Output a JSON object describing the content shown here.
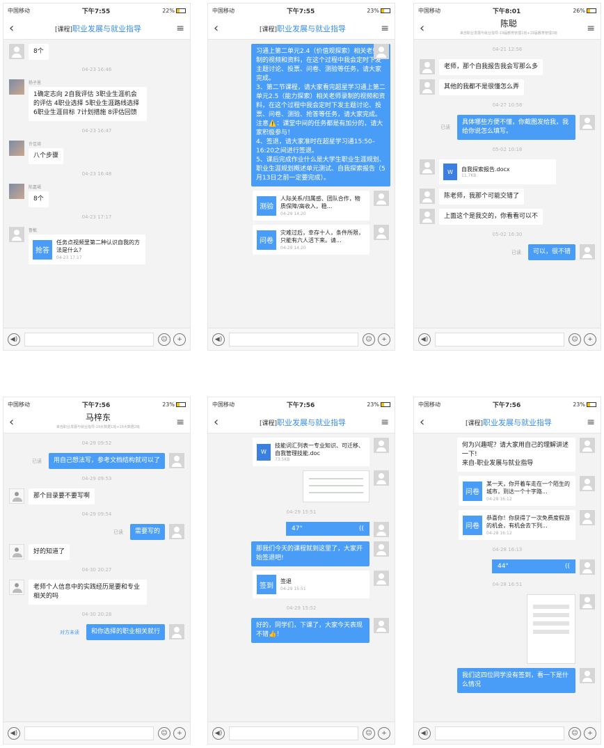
{
  "status_bar": {
    "carrier": "中国移动",
    "battery_icon": "battery-icon"
  },
  "course_tag": "[课程]",
  "course_title": "职业发展与就业指导",
  "back_icon": "‹",
  "menu_icon": "≡",
  "phones": [
    {
      "time": "下午7:55",
      "battery": "22%",
      "messages": [
        {
          "kind": "text",
          "side": "left",
          "text": "8个"
        },
        {
          "kind": "ts",
          "text": "04-23 16:46"
        },
        {
          "kind": "text",
          "side": "left",
          "avatar": "photo",
          "name": "杨子恩",
          "text": "1确定志向 2自我评估 3职业生涯机会的评估 4职业选择 5职业生涯路线选择 6职业生涯目标 7计划措施 8评估回馈"
        },
        {
          "kind": "ts",
          "text": "04-23 16:47"
        },
        {
          "kind": "text",
          "side": "left",
          "avatar": "photo",
          "name": "许佳琦",
          "text": "八个步骤"
        },
        {
          "kind": "ts",
          "text": "04-23 16:48"
        },
        {
          "kind": "text",
          "side": "left",
          "avatar": "photo",
          "name": "陈嘉珺",
          "text": "8个"
        },
        {
          "kind": "ts",
          "text": "04-23 17:17"
        },
        {
          "kind": "card",
          "side": "left",
          "name": "鲁敏",
          "icon": "抢答",
          "title": "任务点视频里第二种认识自我的方法是什么?",
          "date": "04-23 17:17"
        }
      ]
    },
    {
      "time": "下午7:55",
      "battery": "23%",
      "messages": [
        {
          "kind": "text",
          "side": "right",
          "color": "blue",
          "wide": true,
          "text": "习通上第二单元2.4（价值观探索）相关老师录制的视频和资料，在这个过程中我会定时下发主题讨论、投票、问卷、测验等任务，请大家完成。\n3、第二节课程，请大家看完超星学习通上第二单元2.5（能力探索）相关老师录制的视频和资料，在这个过程中我会定时下发主题讨论、投票、问卷、测验、抢答等任务，请大家完成。\n注意⚠️：课堂中间的任务都是有加分的，请大家积极参与！\n4、签退，请大家准时在超星学习通15:50–16:20之间进行签退。\n5、课后完成作业什么是大学生职业生涯规划、职业生涯规划概述单元测试、自我探索报告（5月13日之前一定要完成）。"
        },
        {
          "kind": "card",
          "side": "right",
          "icon": "测验",
          "title": "人际关系/归属感、团队合作，物质保障/高收入，稳...",
          "date": "04-29 14:20"
        },
        {
          "kind": "card",
          "side": "right",
          "icon": "问卷",
          "title": "灾难过后，幸存十人，条件所限，只能有六人活下来。请...",
          "date": "04-29 14:20"
        }
      ]
    },
    {
      "time": "下午8:01",
      "battery": "26%",
      "person": "陈聪",
      "sub": "来自职业发展与就业指导-19届教育管理1班+19届教育管理2班",
      "messages": [
        {
          "kind": "ts",
          "text": "04-21 12:56"
        },
        {
          "kind": "text",
          "side": "left",
          "text": "老师，那个自我报告我会写那么多"
        },
        {
          "kind": "text",
          "side": "left",
          "text": "其他的我都不是很懂怎么弄"
        },
        {
          "kind": "ts",
          "text": "04-27 10:58"
        },
        {
          "kind": "text",
          "side": "right",
          "color": "blue",
          "read": "已读",
          "text": "具体哪些方便不懂，你截图发给我，我给你说怎么填写。"
        },
        {
          "kind": "ts",
          "text": "05-02 10:18"
        },
        {
          "kind": "file",
          "side": "left",
          "filename": "自我探索报告.docx",
          "size": "11.7KB"
        },
        {
          "kind": "text",
          "side": "left",
          "text": "陈老师，我那个可能交错了"
        },
        {
          "kind": "text",
          "side": "left",
          "text": "上面这个是我交的，你看看可以不"
        },
        {
          "kind": "ts",
          "text": "05-02 16:30"
        },
        {
          "kind": "text",
          "side": "right",
          "color": "blue",
          "read": "已读",
          "text": "可以，很不错"
        }
      ]
    },
    {
      "time": "下午7:56",
      "battery": "23%",
      "person": "马梓东",
      "sub": "来自职业发展与就业指导-19大数据1班+19大数据2班",
      "messages": [
        {
          "kind": "ts",
          "text": "04-29 09:52"
        },
        {
          "kind": "text",
          "side": "right",
          "color": "blue",
          "read": "已读",
          "text": "用自己想法写，参考文档结构就可以了"
        },
        {
          "kind": "ts",
          "text": "04-29 09:53"
        },
        {
          "kind": "text",
          "side": "left",
          "avatar": "sketch",
          "text": "那个目录要不要写啊"
        },
        {
          "kind": "ts",
          "text": "04-29 09:54"
        },
        {
          "kind": "text",
          "side": "right",
          "color": "blue",
          "read": "已读",
          "text": "需要写的"
        },
        {
          "kind": "text",
          "side": "left",
          "avatar": "sketch",
          "text": "好的知道了"
        },
        {
          "kind": "ts",
          "text": "04-30 20:27"
        },
        {
          "kind": "text",
          "side": "left",
          "avatar": "sketch",
          "text": "老师个人信息中的实践经历是要和专业相关的吗"
        },
        {
          "kind": "ts",
          "text": "04-30 20:28"
        },
        {
          "kind": "text",
          "side": "right",
          "color": "blue",
          "read": "对方未读",
          "readblue": true,
          "text": "和你选择的职业相关就行"
        }
      ]
    },
    {
      "time": "下午7:56",
      "battery": "23%",
      "messages": [
        {
          "kind": "file",
          "side": "right",
          "filename": "技能词汇列表一专业知识、可迁移、自我管理技能.doc",
          "size": "73.5KB"
        },
        {
          "kind": "image",
          "side": "right"
        },
        {
          "kind": "ts",
          "text": "04-29 15:51"
        },
        {
          "kind": "voice",
          "side": "right",
          "text": "47\""
        },
        {
          "kind": "text",
          "side": "right",
          "color": "blue",
          "text": "那我们今天的课程就到这里了，大家开始签退吧!"
        },
        {
          "kind": "card",
          "side": "right",
          "icon": "签到",
          "title": "签退",
          "date": "04-29 15:51"
        },
        {
          "kind": "ts",
          "text": "04-29 15:52"
        },
        {
          "kind": "text",
          "side": "right",
          "color": "blue",
          "text": "好的，同学们，下课了，大家今天表现不错👍！"
        }
      ]
    },
    {
      "time": "下午7:56",
      "battery": "23%",
      "messages": [
        {
          "kind": "text",
          "side": "right",
          "text": "何为兴趣呢？请大家用自己的理解讲述一下!\n来自-职业发展与就业指导"
        },
        {
          "kind": "card",
          "side": "right",
          "icon": "问卷",
          "title": "某一天，你开着车走在一个陌生的城市，到达一个十字路...",
          "date": "04-28 16:12"
        },
        {
          "kind": "card",
          "side": "right",
          "icon": "问卷",
          "title": "恭喜你！你获得了一次免费度假游的机会，有机会去下列...",
          "date": "04-28 16:12"
        },
        {
          "kind": "ts",
          "text": "04-28 16:13"
        },
        {
          "kind": "voice",
          "side": "right",
          "text": "44\""
        },
        {
          "kind": "ts",
          "text": "04-28 16:51"
        },
        {
          "kind": "imagetall",
          "side": "right"
        },
        {
          "kind": "text",
          "side": "right",
          "color": "blue",
          "text": "我们这四位同学没有签到，看一下是什么情况"
        }
      ]
    }
  ]
}
